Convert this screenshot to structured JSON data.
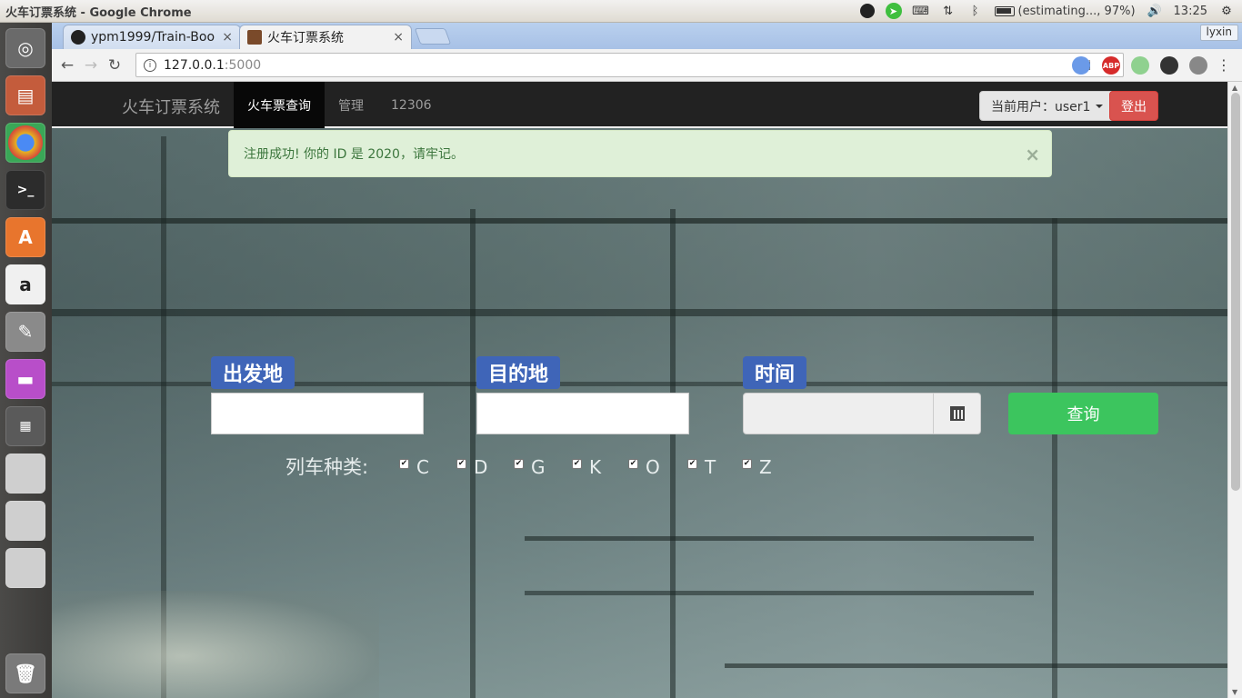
{
  "os": {
    "window_title": "火车订票系统 - Google Chrome",
    "battery_text": "(estimating..., 97%)",
    "clock": "13:25"
  },
  "browser": {
    "tabs": [
      {
        "label": "ypm1999/Train-Boo"
      },
      {
        "label": "火车订票系统"
      }
    ],
    "tab_close": "×",
    "profile_name": "lyxin",
    "url_host": "127.0.0.1",
    "url_port": ":5000",
    "ext_abp": "ABP"
  },
  "navbar": {
    "brand": "火车订票系统",
    "links": [
      "火车票查询",
      "管理",
      "12306"
    ],
    "user_label": "当前用户：user1",
    "logout": "登出"
  },
  "alert": {
    "message": "注册成功! 你的 ID 是 2020，请牢记。",
    "close": "×"
  },
  "search": {
    "from_label": "出发地",
    "to_label": "目的地",
    "time_label": "时间",
    "from_value": "",
    "to_value": "",
    "date_value": "",
    "submit": "查询",
    "train_type_label": "列车种类:",
    "train_types": [
      {
        "code": "C",
        "checked": true
      },
      {
        "code": "D",
        "checked": true
      },
      {
        "code": "G",
        "checked": true
      },
      {
        "code": "K",
        "checked": true
      },
      {
        "code": "O",
        "checked": true
      },
      {
        "code": "T",
        "checked": true
      },
      {
        "code": "Z",
        "checked": true
      }
    ]
  },
  "colors": {
    "navbar_bg": "#222222",
    "badge_blue": "#3f65b8",
    "query_green": "#3cc55e",
    "logout_red": "#d9534f",
    "alert_green_bg": "#dff0d8"
  }
}
